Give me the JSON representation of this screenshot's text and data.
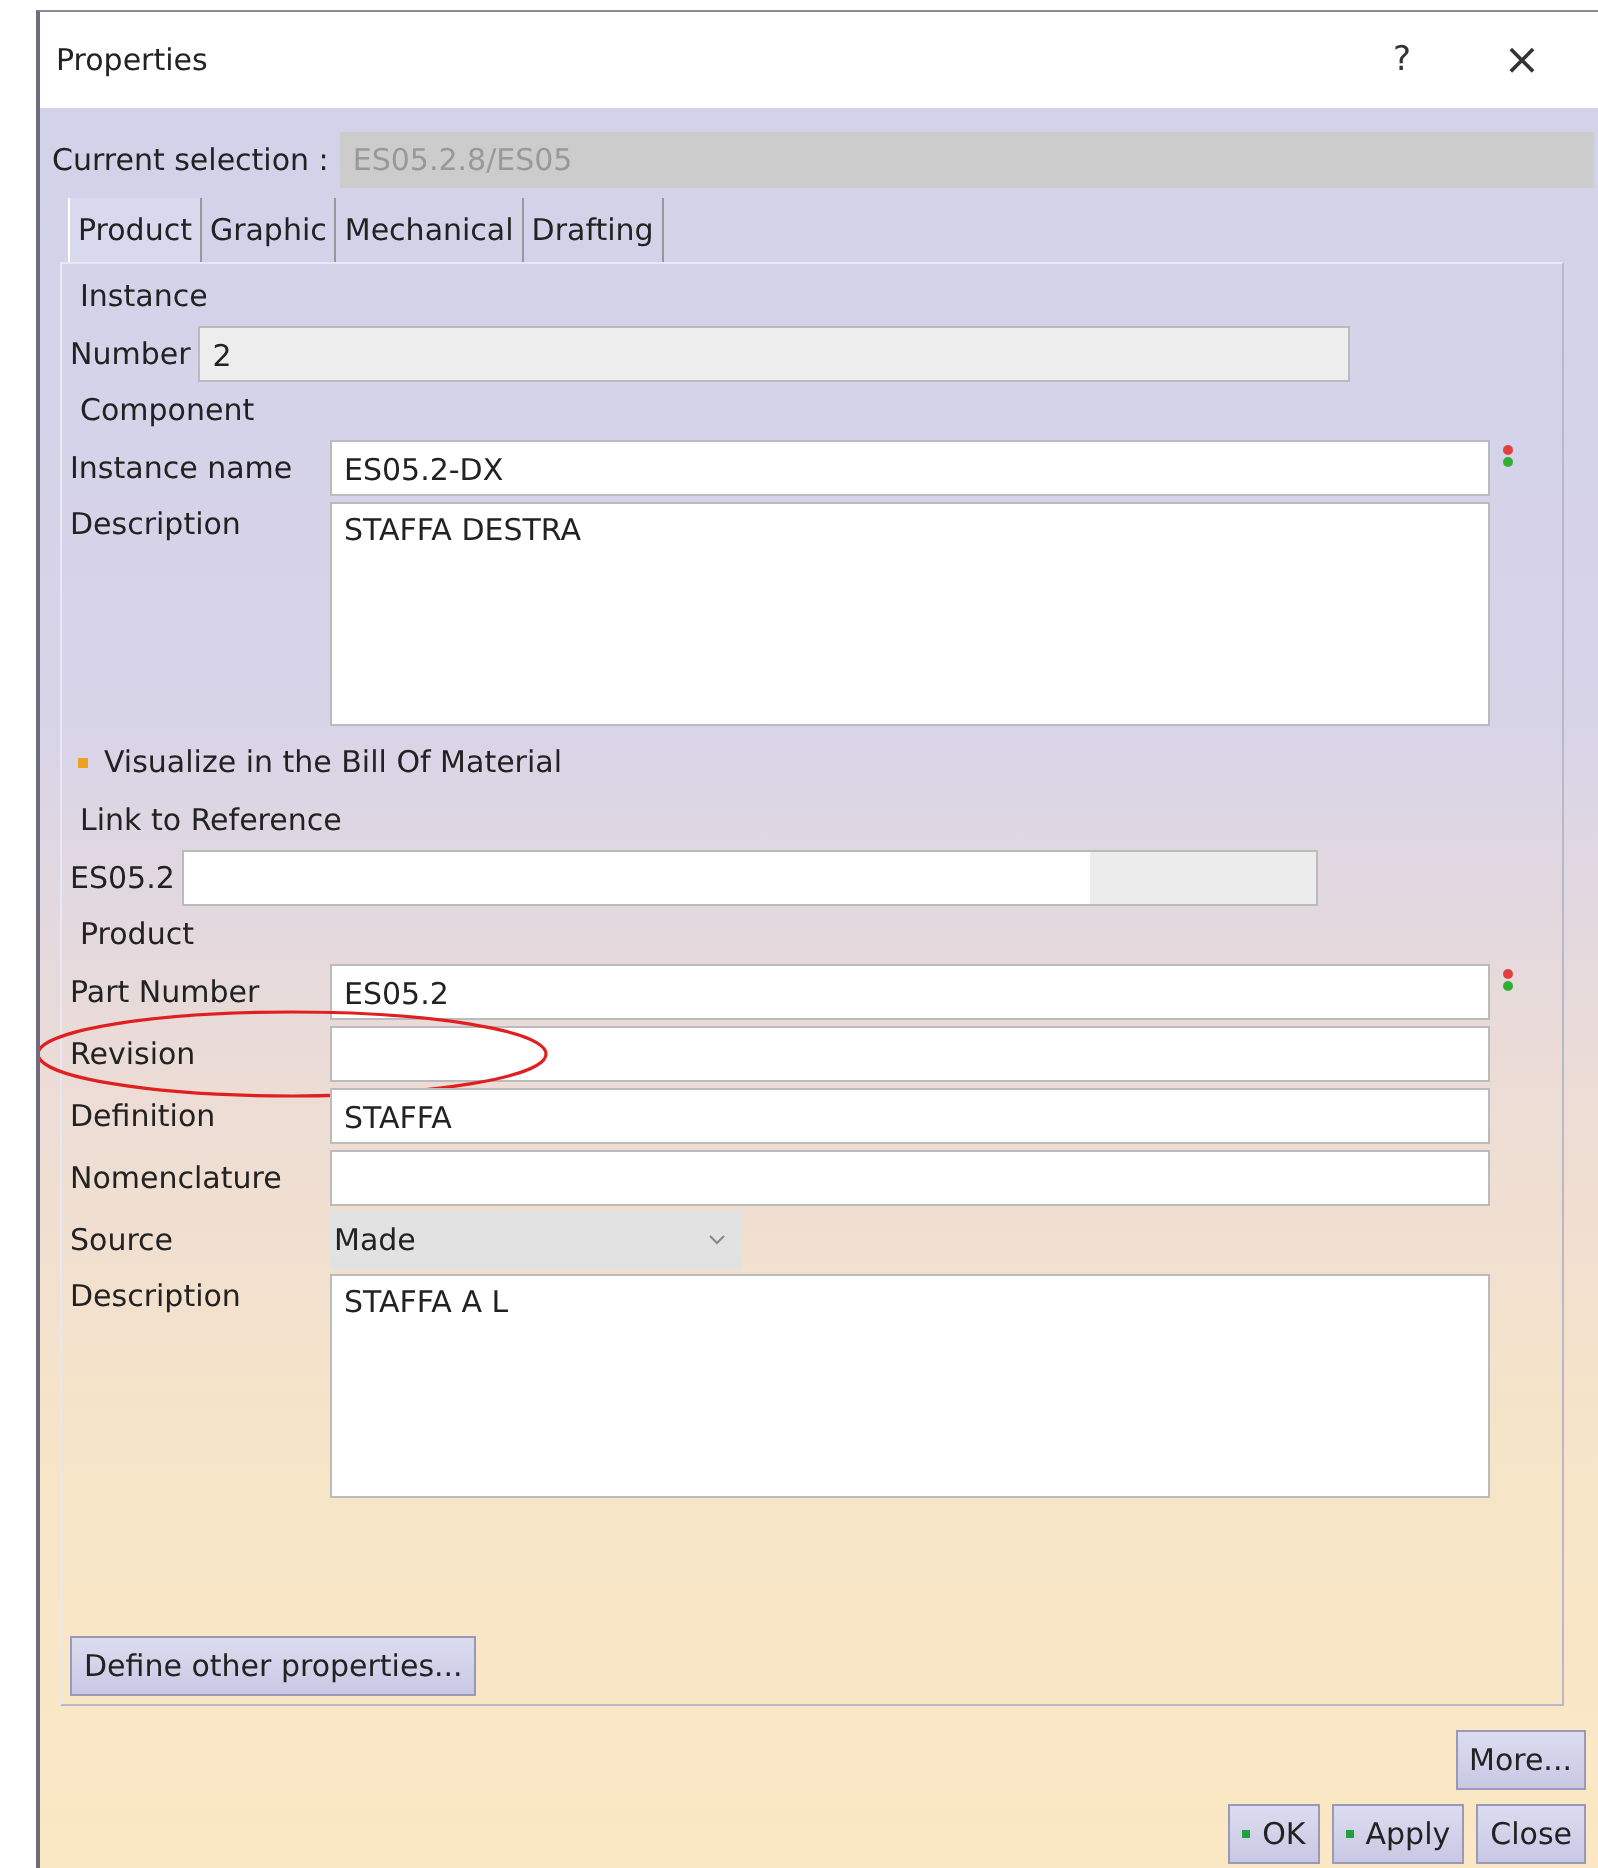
{
  "window": {
    "title": "Properties",
    "help": "?",
    "close": "×"
  },
  "current_selection": {
    "label": "Current selection :",
    "value": "ES05.2.8/ES05",
    "disabled": true
  },
  "tabs": [
    {
      "label": "Product",
      "selected": true
    },
    {
      "label": "Graphic",
      "selected": false
    },
    {
      "label": "Mechanical",
      "selected": false
    },
    {
      "label": "Drafting",
      "selected": false
    }
  ],
  "instance": {
    "title": "Instance",
    "fields": [
      {
        "label": "Number",
        "value": "2",
        "kind": "text",
        "disabled": true
      }
    ]
  },
  "component": {
    "title": "Component",
    "fields": [
      {
        "label": "Instance name",
        "value": "ES05.2-DX",
        "kind": "text",
        "disabled": false,
        "status": true
      },
      {
        "label": "Description",
        "value": "STAFFA DESTRA",
        "kind": "textarea",
        "disabled": false
      }
    ],
    "option": {
      "label": "Visualize in the Bill Of Material"
    }
  },
  "link_to_reference": {
    "title": "Link to Reference",
    "fields": [
      {
        "label": "ES05.2",
        "kind": "reference",
        "disabled": true
      }
    ]
  },
  "product": {
    "title": "Product",
    "fields": [
      {
        "label": "Part Number",
        "value": "ES05.2",
        "kind": "text",
        "disabled": false,
        "status": true
      },
      {
        "label": "Revision",
        "kind": "text",
        "disabled": false,
        "highlighted": true
      },
      {
        "label": "Definition",
        "value": "STAFFA",
        "kind": "text",
        "disabled": false
      },
      {
        "label": "Nomenclature",
        "kind": "text",
        "disabled": false
      },
      {
        "label": "Source",
        "value": "Made",
        "kind": "select",
        "disabled": false
      },
      {
        "label": "Description",
        "value": "STAFFA A L",
        "kind": "textarea",
        "disabled": false
      }
    ]
  },
  "define_button": "Define other properties...",
  "more_button": "More...",
  "buttons": [
    {
      "label": "OK",
      "dot": true
    },
    {
      "label": "Apply",
      "dot": true
    },
    {
      "label": "Close",
      "dot": false
    }
  ]
}
